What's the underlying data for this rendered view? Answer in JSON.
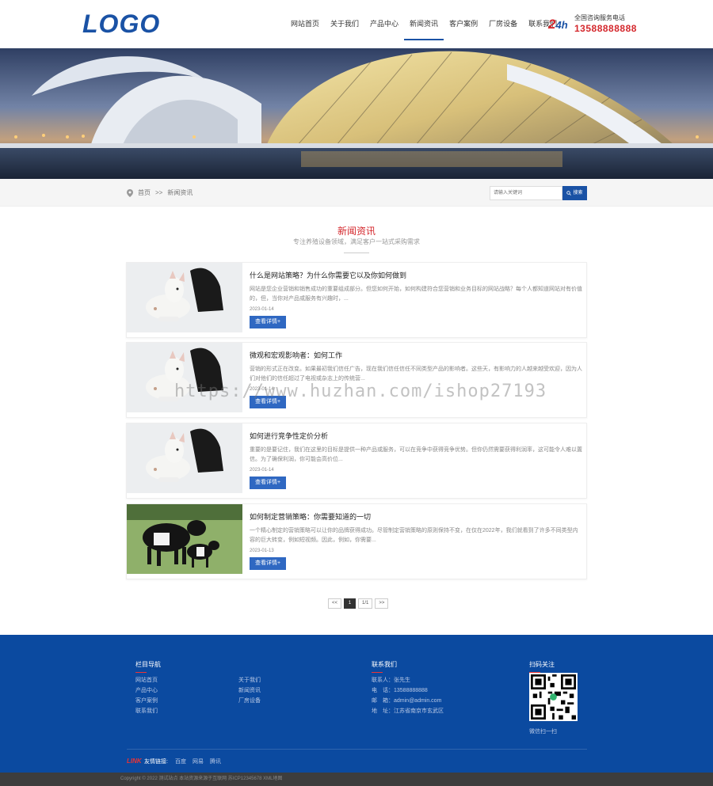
{
  "header": {
    "logo": "LOGO",
    "nav": [
      {
        "label": "网站首页"
      },
      {
        "label": "关于我们"
      },
      {
        "label": "产品中心"
      },
      {
        "label": "新闻资讯",
        "active": true
      },
      {
        "label": "客户案例"
      },
      {
        "label": "厂房设备"
      },
      {
        "label": "联系我们"
      }
    ],
    "hotline_badge": "2",
    "hotline_badge_small": "4h",
    "hotline_label": "全国咨询服务电话",
    "hotline_number": "13588888888"
  },
  "breadcrumb": {
    "home": "首页",
    "separator": ">>",
    "current": "新闻资讯"
  },
  "search": {
    "placeholder": "请输入关键词",
    "button": "搜索"
  },
  "section": {
    "title": "新闻资讯",
    "subtitle": "专注养殖设备领域，满足客户一站式采购需求"
  },
  "news": [
    {
      "title": "什么是网站策略？为什么你需要它以及你如何做到",
      "desc": "网站是您企业营销和销售成功的重要组成部分。但您如何开始，如何构建符合您营销和业务目标的网站战略？每个人都知道网站对有价值的，但，当你对产品或服务有兴趣时，...",
      "date": "2023-01-14",
      "button": "查看详情+"
    },
    {
      "title": "微观和宏观影响者：如何工作",
      "desc": "营销的形式正在改变。如果最初我们信任广告，现在我们信任信任不同类型产品的影响者。这些天，有影响力的人越来越受欢迎，因为人们对他们的信任超过了电视或杂志上的传统营...",
      "date": "2023-01-14",
      "button": "查看详情+"
    },
    {
      "title": "如何进行竞争性定价分析",
      "desc": "重要的是要记住，我们在这里的目标是提供一种产品或服务，可以在竞争中获得竞争优势。但你仍然需要获得利润率，这可能令人难以置信。为了确保利润，你可能会高价位...",
      "date": "2023-01-14",
      "button": "查看详情+"
    },
    {
      "title": "如何制定营销策略：你需要知道的一切",
      "desc": "一个精心制定的营销策略可以让你的品牌获得成功。尽管制定营销策略的原则保持不变，在仅在2022年，我们就看到了许多不同类型内容的巨大转变，例如短视频。因此，例如，你需要...",
      "date": "2023-01-13",
      "button": "查看详情+"
    }
  ],
  "pager": {
    "prev": "<<",
    "current": "1",
    "total": "1/1",
    "next": ">>"
  },
  "footer": {
    "nav_title": "栏目导航",
    "nav_links": [
      "网站首页",
      "关于我们",
      "产品中心",
      "新闻资讯",
      "客户案例",
      "厂房设备",
      "联系我们"
    ],
    "contact_title": "联系我们",
    "contact_lines": [
      "联系人：张先生",
      "电　话：13588888888",
      "邮　箱：admin@admin.com",
      "地　址：江苏省南京市玄武区"
    ],
    "qr_title": "扫码关注",
    "qr_caption": "微信扫一扫",
    "links_logo": "LINK",
    "links_label": "友情链接:",
    "links": [
      "百度",
      "网易",
      "腾讯"
    ],
    "copyright": "Copyright © 2022 测试站点 本站资源来源于互联网 苏ICP12345678 XML地图"
  },
  "watermark": "https://www.huzhan.com/ishop27193",
  "colors": {
    "brand_blue": "#1a52a5",
    "accent_red": "#d4272c",
    "footer_blue": "#0b4aa0"
  }
}
